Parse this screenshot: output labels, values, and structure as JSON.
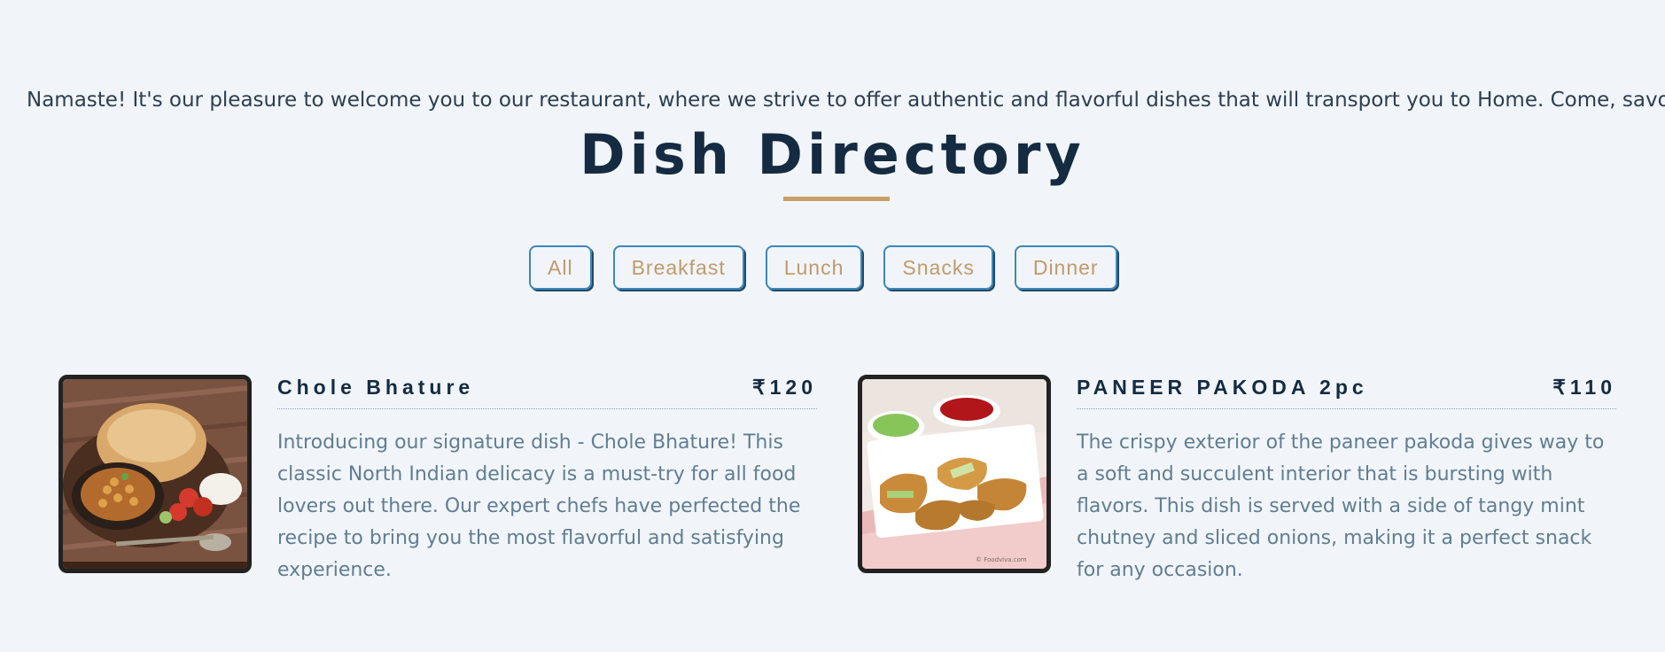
{
  "welcome_text": "Namaste! It's our pleasure to welcome you to our restaurant, where we strive to offer authentic and flavorful dishes that will transport you to Home. Come, savor the e",
  "page_title": "Dish Directory",
  "colors": {
    "background": "#f1f5f9",
    "title": "#142b42",
    "accent_gold": "#c8a067",
    "filter_border": "#3d87b9",
    "description": "#617d93"
  },
  "filters": [
    {
      "label": "All"
    },
    {
      "label": "Breakfast"
    },
    {
      "label": "Lunch"
    },
    {
      "label": "Snacks"
    },
    {
      "label": "Dinner"
    }
  ],
  "dishes": [
    {
      "name": "Chole Bhature",
      "price": "₹120",
      "description": "Introducing our signature dish - Chole Bhature! This classic North Indian delicacy is a must-try for all food lovers out there. Our expert chefs have perfected the recipe to bring you the most flavorful and satisfying experience.",
      "image_icon": "chole-bhature-photo"
    },
    {
      "name": "PANEER PAKODA 2pc",
      "price": "₹110",
      "description": "The crispy exterior of the paneer pakoda gives way to a soft and succulent interior that is bursting with flavors. This dish is served with a side of tangy mint chutney and sliced onions, making it a perfect snack for any occasion.",
      "image_icon": "paneer-pakoda-photo"
    }
  ]
}
